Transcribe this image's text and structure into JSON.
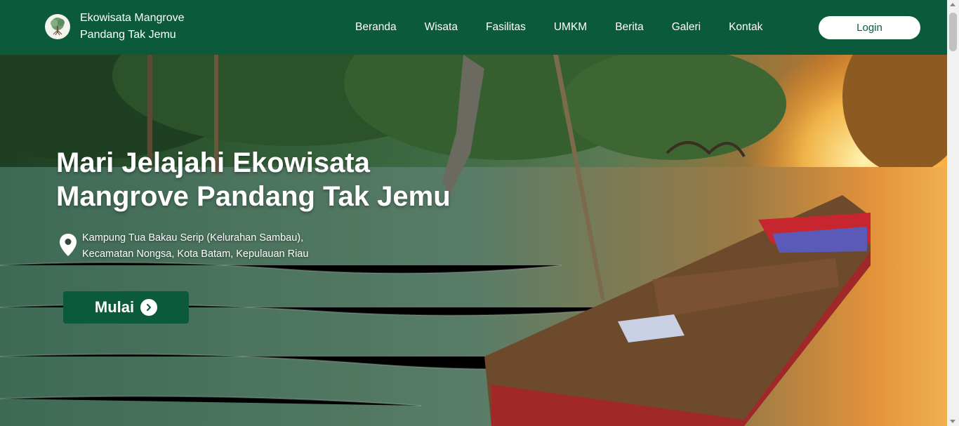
{
  "brand": {
    "line1": "Ekowisata Mangrove",
    "line2": "Pandang Tak Jemu",
    "logo_icon": "mangrove-tree-icon"
  },
  "nav": {
    "items": [
      {
        "label": "Beranda"
      },
      {
        "label": "Wisata"
      },
      {
        "label": "Fasilitas"
      },
      {
        "label": "UMKM"
      },
      {
        "label": "Berita"
      },
      {
        "label": "Galeri"
      },
      {
        "label": "Kontak"
      }
    ],
    "login_label": "Login"
  },
  "hero": {
    "title_line1": "Mari Jelajahi Ekowisata",
    "title_line2": "Mangrove Pandang Tak Jemu",
    "location_line1": "Kampung Tua Bakau Serip (Kelurahan Sambau),",
    "location_line2": "Kecamatan Nongsa, Kota Batam, Kepulauan Riau",
    "location_icon": "map-pin-icon",
    "cta_label": "Mulai",
    "cta_icon": "chevron-right-circle-icon"
  },
  "colors": {
    "primary": "#0b5a3c",
    "white": "#ffffff"
  }
}
